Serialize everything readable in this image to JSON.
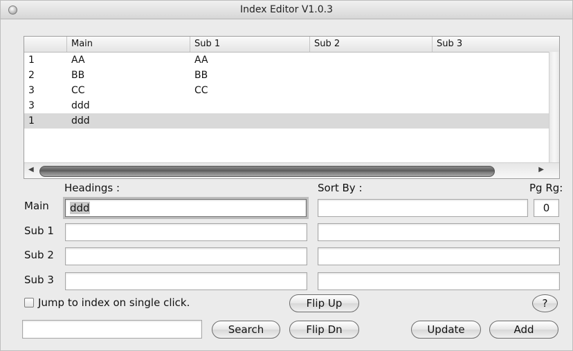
{
  "window": {
    "title": "Index Editor V1.0.3"
  },
  "table": {
    "columns": [
      "",
      "Main",
      "Sub 1",
      "Sub 2",
      "Sub 3"
    ],
    "rows": [
      [
        "1",
        "AA",
        "AA",
        "",
        ""
      ],
      [
        "2",
        "BB",
        "BB",
        "",
        ""
      ],
      [
        "3",
        "CC",
        "CC",
        "",
        ""
      ],
      [
        "3",
        "ddd",
        "",
        "",
        ""
      ],
      [
        "1",
        "ddd",
        "",
        "",
        ""
      ]
    ],
    "selected_row": 4
  },
  "labels": {
    "headings": "Headings :",
    "sort_by": "Sort By :",
    "pg_rg": "Pg Rg:",
    "main": "Main",
    "sub1": "Sub 1",
    "sub2": "Sub 2",
    "sub3": "Sub 3"
  },
  "fields": {
    "main_heading": "ddd",
    "main_sort": "",
    "pg_rg": "0",
    "sub1_heading": "",
    "sub1_sort": "",
    "sub2_heading": "",
    "sub2_sort": "",
    "sub3_heading": "",
    "sub3_sort": "",
    "search": ""
  },
  "checkbox": {
    "label": "Jump to index on single click.",
    "checked": false
  },
  "buttons": {
    "flip_up": "Flip Up",
    "flip_dn": "Flip Dn",
    "search": "Search",
    "help": "?",
    "update": "Update",
    "add": "Add"
  }
}
